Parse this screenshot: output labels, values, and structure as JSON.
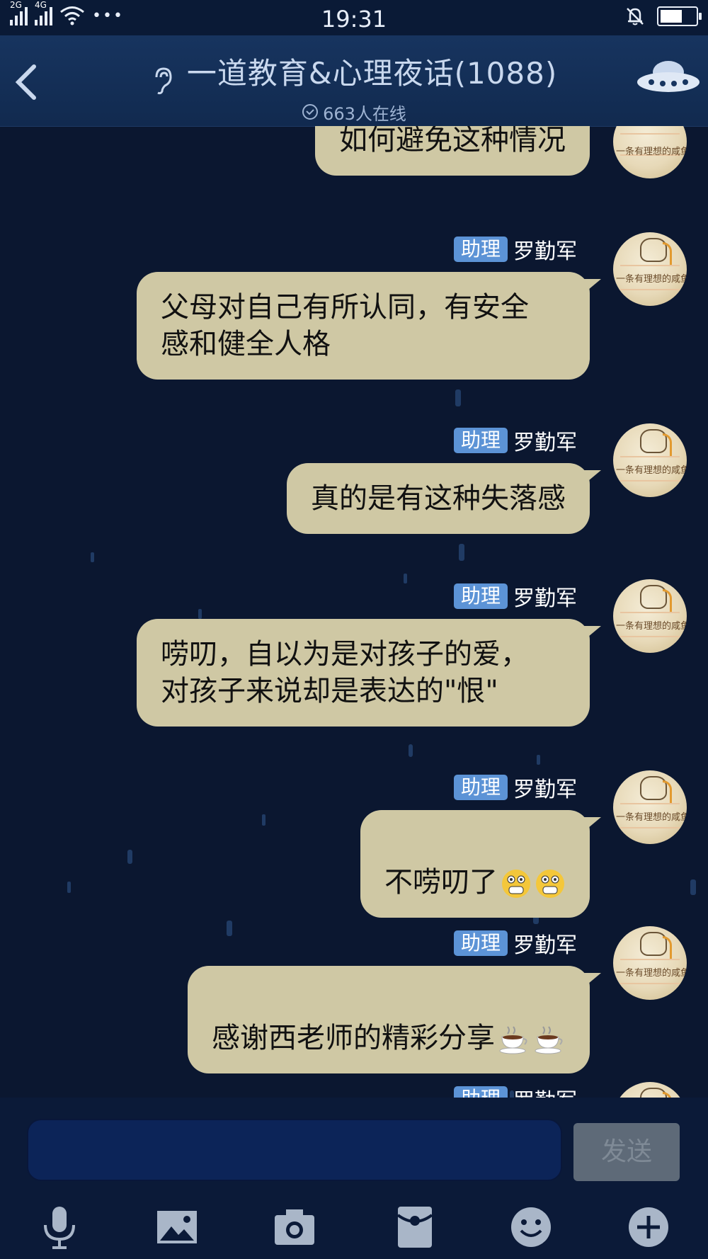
{
  "status_bar": {
    "time": "19:31",
    "signal1_label": "2G",
    "signal2_label": "4G",
    "more": "•••"
  },
  "header": {
    "title": "一道教育&心理夜话(1088)",
    "online_text": "663人在线"
  },
  "messages": [
    {
      "badge": "",
      "sender": "",
      "text": "如何避免这种情况"
    },
    {
      "badge": "助理",
      "sender": "罗勤军",
      "text": "父母对自己有所认同，有安全\n感和健全人格"
    },
    {
      "badge": "助理",
      "sender": "罗勤军",
      "text": "真的是有这种失落感"
    },
    {
      "badge": "助理",
      "sender": "罗勤军",
      "text": "唠叨，自以为是对孩子的爱，\n对孩子来说却是表达的\"恨\""
    },
    {
      "badge": "助理",
      "sender": "罗勤军",
      "text": "不唠叨了"
    },
    {
      "badge": "助理",
      "sender": "罗勤军",
      "text": "感谢西老师的精彩分享"
    },
    {
      "badge": "助理",
      "sender": "罗勤军",
      "text": ""
    }
  ],
  "avatar_text": "一条有理想的咸鱼",
  "input": {
    "placeholder": "",
    "send_label": "发送"
  },
  "toolbar": {
    "icons": [
      "microphone-icon",
      "image-icon",
      "camera-icon",
      "red-packet-icon",
      "emoji-icon",
      "plus-icon"
    ]
  },
  "colors": {
    "background": "#0b1730",
    "header": "#17345f",
    "bubble": "#cfc8a4",
    "badge": "#5c93d6",
    "input": "#0c2458"
  }
}
